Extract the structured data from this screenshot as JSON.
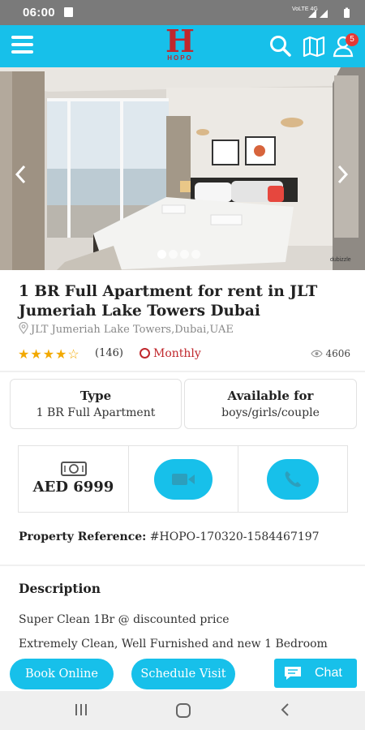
{
  "status_bar": {
    "time": "06:00",
    "network": "VoLTE 4G"
  },
  "header": {
    "logo_letter": "H",
    "logo_text": "HOPO",
    "notification_count": "5"
  },
  "listing": {
    "title": "1 BR Full Apartment for rent in JLT Jumeriah Lake Towers Dubai",
    "location": "JLT Jumeriah Lake Towers,Dubai,UAE",
    "rating": 4,
    "rating_max": 5,
    "reviews": "(146)",
    "period": "Monthly",
    "views": "4606",
    "photo_index": 1,
    "photo_count": 4,
    "watermark": "dubizzle"
  },
  "info": {
    "type_label": "Type",
    "type_value": "1 BR Full Apartment",
    "available_label": "Available for",
    "available_value": "boys/girls/couple"
  },
  "price": "AED 6999",
  "reference": {
    "label": "Property Reference:",
    "value": "#HOPO-170320-1584467197"
  },
  "description": {
    "title": "Description",
    "lines": [
      "Super Clean 1Br @ discounted price",
      "Extremely Clean, Well Furnished and new 1 Bedroom"
    ]
  },
  "buttons": {
    "book": "Book Online",
    "visit": "Schedule Visit",
    "chat": "Chat"
  },
  "colors": {
    "accent": "#17c0ea",
    "brand_red": "#c0282d",
    "star": "#f2a900"
  }
}
